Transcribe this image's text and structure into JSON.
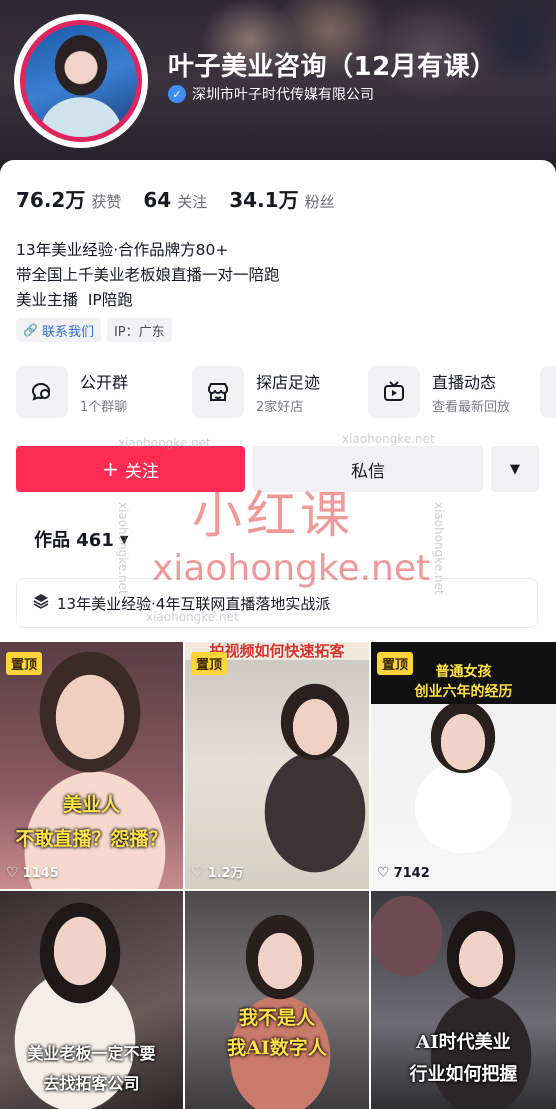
{
  "profile": {
    "name": "叶子美业咨询（12月有课）",
    "verified_org": "深圳市叶子时代传媒有限公司"
  },
  "stats": [
    {
      "value": "76.2万",
      "label": "获赞"
    },
    {
      "value": "64",
      "label": "关注"
    },
    {
      "value": "34.1万",
      "label": "粉丝"
    }
  ],
  "bio": {
    "line1": "13年美业经验·合作品牌方80+",
    "line2": "带全国上千美业老板娘直播一对一陪跑",
    "line3": "美业主播  IP陪跑"
  },
  "tags": {
    "contact": "联系我们",
    "ip": "IP：广东"
  },
  "features": [
    {
      "title": "公开群",
      "sub": "1个群聊",
      "icon": "group-chat-icon"
    },
    {
      "title": "探店足迹",
      "sub": "2家好店",
      "icon": "shop-icon"
    },
    {
      "title": "直播动态",
      "sub": "查看最新回放",
      "icon": "live-tv-icon"
    }
  ],
  "actions": {
    "follow": "关注",
    "message": "私信"
  },
  "works": {
    "label": "作品 461"
  },
  "collection": {
    "label": "13年美业经验·4年互联网直播落地实战派"
  },
  "watermarks": {
    "big": "小红课",
    "url": "xiaohongke.net",
    "small": "xiaohongke.net"
  },
  "videos": [
    {
      "pinned": "置顶",
      "likes": "1145",
      "caption": "美业人\n不敢直播？怨播？"
    },
    {
      "pinned": "置顶",
      "likes": "1.2万",
      "caption": "拍视频如何快速拓客"
    },
    {
      "pinned": "置顶",
      "likes": "7142",
      "caption": "普通女孩\n创业六年的经历"
    },
    {
      "caption": "美业老板一定不要\n去找拓客公司"
    },
    {
      "caption": "我不是人\n我AI数字人"
    },
    {
      "caption": "AI时代美业\n行业如何把握"
    }
  ],
  "colors": {
    "accent": "#fe2c55",
    "pin": "#ffd43b",
    "verify": "#3f8ef5",
    "watermark": "#e44646"
  }
}
